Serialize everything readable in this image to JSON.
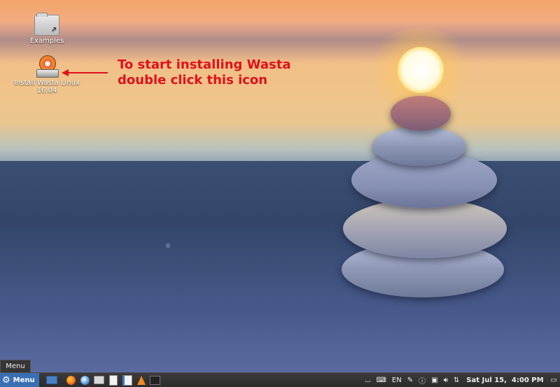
{
  "desktop": {
    "icons": [
      {
        "label": "Examples"
      },
      {
        "label": "Install Wasta Linux 16.04"
      }
    ],
    "annotation": {
      "line1": "To start installing Wasta",
      "line2": "double click this icon",
      "color": "#e0101a"
    }
  },
  "tooltip": {
    "text": "Menu"
  },
  "taskbar": {
    "menu_label": "Menu",
    "launchers": [
      "show-desktop-icon",
      "firefox-icon",
      "thunderbird-icon",
      "files-icon",
      "document-icon",
      "pdf-icon",
      "vlc-icon",
      "terminal-icon"
    ],
    "tray": {
      "keyboard_layout": "EN"
    },
    "clock": "Sat Jul 15,  4:00 PM"
  },
  "colors": {
    "taskbar_bg": "#2c2c2c",
    "menu_button_bg": "#3a6fb4",
    "annotation_red": "#e0101a"
  }
}
